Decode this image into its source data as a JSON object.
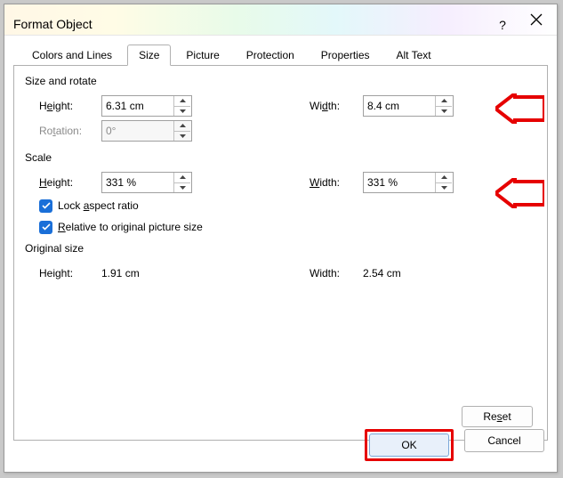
{
  "title": "Format Object",
  "tabs": {
    "colors_lines": "Colors and Lines",
    "size": "Size",
    "picture": "Picture",
    "protection": "Protection",
    "properties": "Properties",
    "alt_text": "Alt Text"
  },
  "section": {
    "size_rotate": "Size and rotate",
    "scale": "Scale",
    "original": "Original size"
  },
  "size_rotate": {
    "height_label_pre": "H",
    "height_label_ul": "e",
    "height_label_post": "ight:",
    "height_value": "6.31 cm",
    "width_label_pre": "Wi",
    "width_label_ul": "d",
    "width_label_post": "th:",
    "width_value": "8.4 cm",
    "rotation_label_pre": "Ro",
    "rotation_label_post": "ation:",
    "rotation_value": "0°"
  },
  "scale": {
    "height_label_ul": "H",
    "height_label_post": "eight:",
    "height_value": "331 %",
    "width_label_ul": "W",
    "width_label_post": "idth:",
    "width_value": "331 %"
  },
  "checks": {
    "lock_pre": "Lock ",
    "lock_ul": "a",
    "lock_post": "spect ratio",
    "relative_ul": "R",
    "relative_post": "elative to original picture size"
  },
  "original": {
    "height_label": "Height:",
    "height_value": "1.91 cm",
    "width_label": "Width:",
    "width_value": "2.54 cm"
  },
  "buttons": {
    "reset_pre": "Re",
    "reset_ul": "s",
    "reset_post": "et",
    "ok": "OK",
    "cancel": "Cancel"
  }
}
